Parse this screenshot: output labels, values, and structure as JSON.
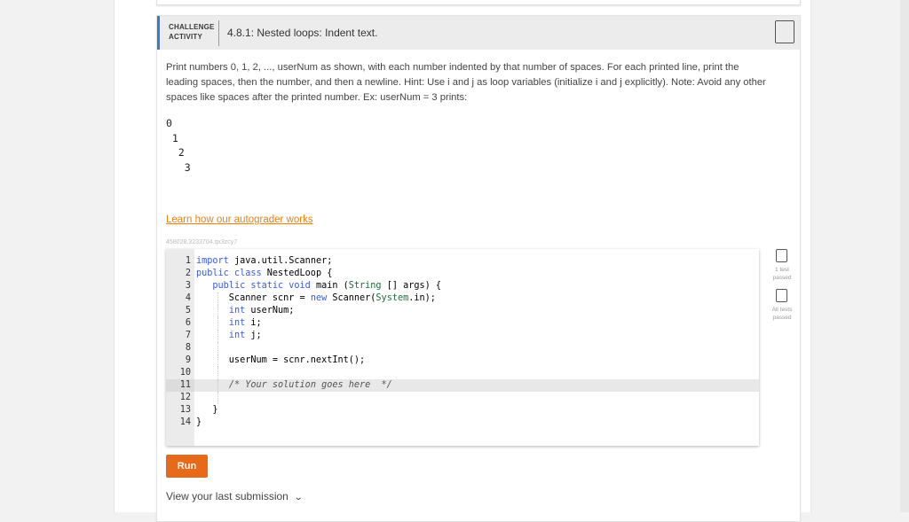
{
  "header": {
    "badge_line1": "CHALLENGE",
    "badge_line2": "ACTIVITY",
    "title": "4.8.1: Nested loops: Indent text."
  },
  "description": "Print numbers 0, 1, 2, ..., userNum as shown, with each number indented by that number of spaces. For each printed line, print the leading spaces, then the number, and then a newline. Hint: Use i and j as loop variables (initialize i and j explicitly). Note: Avoid any other spaces like spaces after the printed number. Ex: userNum = 3 prints:",
  "example_output": "0\n 1\n  2\n   3",
  "learn_link": "Learn how our autograder works",
  "activity_id": "458028.3233704.qx3zcy7",
  "code_lines": [
    "1",
    "2",
    "3",
    "4",
    "5",
    "6",
    "7",
    "8",
    "9",
    "10",
    "11",
    "12",
    "13",
    "14"
  ],
  "run_label": "Run",
  "last_submission": "View your last submission",
  "tests": {
    "test1_line1": "1 test",
    "test1_line2": "passed",
    "test2_line1": "All tests",
    "test2_line2": "passed"
  },
  "icons": {
    "bookmark": "bookmark-icon",
    "chevron": "chevron-down-icon"
  },
  "colors": {
    "accent_blue": "#3a78c9",
    "run_orange": "#e66a1a",
    "link_orange": "#e8820e",
    "keyword": "#3b5bdb",
    "type": "#1c6e3c"
  }
}
